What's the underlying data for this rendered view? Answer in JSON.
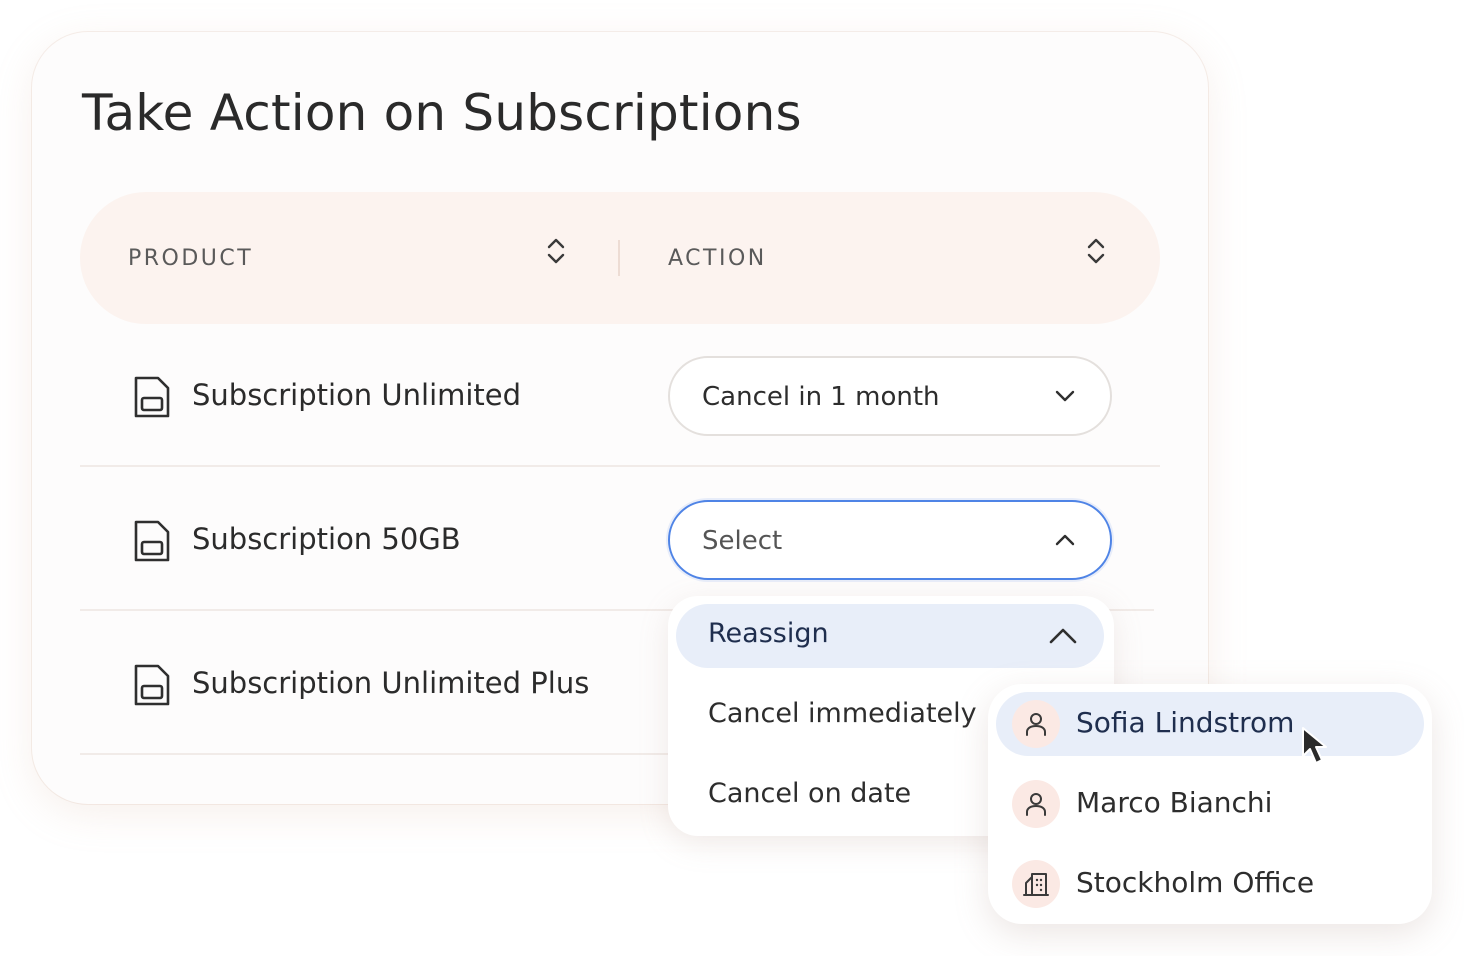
{
  "title": "Take Action on Subscriptions",
  "table": {
    "headers": [
      {
        "label": "PRODUCT",
        "sort_icon": "sort-updown-icon"
      },
      {
        "label": "ACTION",
        "sort_icon": "sort-updown-icon"
      }
    ],
    "rows": [
      {
        "product": "Subscription Unlimited",
        "icon": "sim-card-icon",
        "action": "Cancel in 1 month",
        "action_state": "closed"
      },
      {
        "product": "Subscription 50GB",
        "icon": "sim-card-icon",
        "action": "Select",
        "action_state": "open"
      },
      {
        "product": "Subscription Unlimited Plus",
        "icon": "sim-card-icon",
        "action": "",
        "action_state": "hidden"
      }
    ]
  },
  "action_menu": {
    "items": [
      {
        "label": "Reassign",
        "highlighted": true,
        "expanded": true
      },
      {
        "label": "Cancel immediately"
      },
      {
        "label": "Cancel on date"
      }
    ]
  },
  "reassign_menu": {
    "items": [
      {
        "label": "Sofia Lindstrom",
        "icon": "person-icon",
        "highlighted": true
      },
      {
        "label": "Marco Bianchi",
        "icon": "person-icon"
      },
      {
        "label": "Stockholm Office",
        "icon": "building-icon"
      }
    ]
  },
  "colors": {
    "header_bg": "#fcf3ef",
    "focus_border": "#4f84e6",
    "highlight_bg": "#e8eef9",
    "avatar_bg": "#fbe9e4"
  }
}
